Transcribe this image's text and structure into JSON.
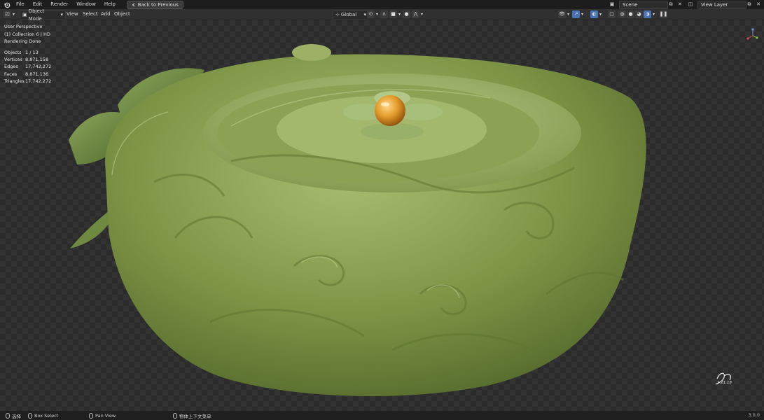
{
  "topbar": {
    "menus": [
      "File",
      "Edit",
      "Render",
      "Window",
      "Help"
    ],
    "back_button": "Back to Previous",
    "scene_label": "Scene",
    "view_layer_label": "View Layer"
  },
  "header": {
    "mode": "Object Mode",
    "menus": [
      "View",
      "Select",
      "Add",
      "Object"
    ],
    "transform_orientation": "Global"
  },
  "viewport": {
    "perspective": "User Perspective",
    "collection": "(1) Collection 6 | HD",
    "render_status": "Rendering Done",
    "stats": [
      {
        "label": "Objects",
        "value": "1 / 13"
      },
      {
        "label": "Vertices",
        "value": "8,871,158"
      },
      {
        "label": "Edges",
        "value": "17,742,272"
      },
      {
        "label": "Faces",
        "value": "8,871,136"
      },
      {
        "label": "Triangles",
        "value": "17,742,272"
      }
    ],
    "signature_date": "2.21.18",
    "colors": {
      "jade_light": "#9fb46a",
      "jade_mid": "#7d9445",
      "jade_dark": "#4e6328",
      "amber": "#e39b2a"
    }
  },
  "statusbar": {
    "select": "选择",
    "box_select": "Box Select",
    "pan_view": "Pan View",
    "context_menu": "物体上下文菜单",
    "version": "3.0.0"
  }
}
